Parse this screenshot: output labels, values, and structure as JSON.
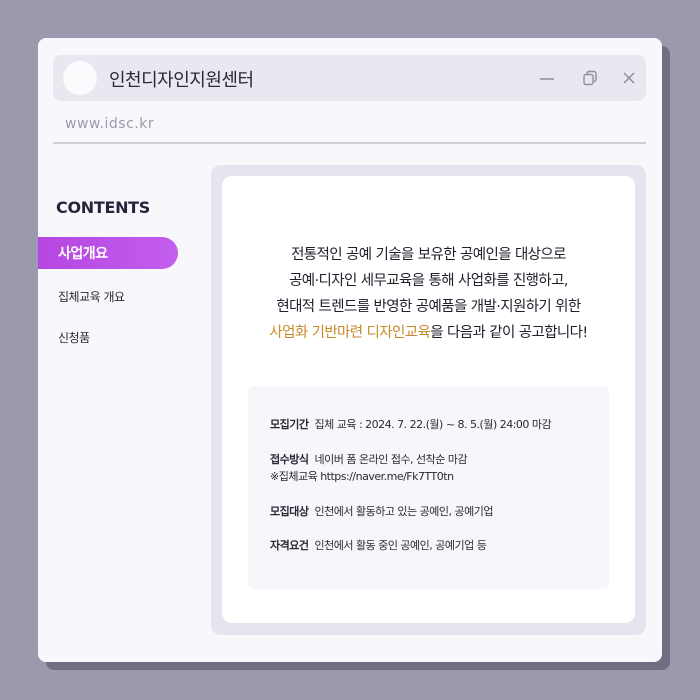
{
  "window": {
    "title": "인천디자인지원센터",
    "url": "www.idsc.kr"
  },
  "sidebar": {
    "heading": "CONTENTS",
    "items": [
      {
        "label": "사업개요",
        "active": true
      },
      {
        "label": "집체교육 개요",
        "active": false
      },
      {
        "label": "신청품",
        "active": false
      }
    ]
  },
  "intro": {
    "line1": "전통적인 공예 기술을 보유한 공예인을 대상으로",
    "line2": "공예·디자인 세무교육을 통해 사업화를 진행하고,",
    "line3": "현대적 트렌드를 반영한 공예품을 개발·지원하기 위한",
    "line4_highlight": "사업화 기반마련 디자인교육",
    "line4_rest": "을 다음과 같이 공고합니다!"
  },
  "info": {
    "rows": [
      {
        "label": "모집기간",
        "value": "집체 교육 : 2024. 7. 22.(월) ~ 8. 5.(월) 24:00 마감"
      },
      {
        "label": "접수방식",
        "value": "네이버 폼 온라인 접수, 선착순 마감",
        "extra": "※집체교육 https://naver.me/Fk7TT0tn"
      },
      {
        "label": "모집대상",
        "value": "인천에서 활동하고 있는 공예인, 공예기업"
      },
      {
        "label": "자격요건",
        "value": "인천에서 활동 중인 공예인, 공예기업 등"
      }
    ]
  },
  "colors": {
    "accent": "#c35eee",
    "highlight": "#c98a2a",
    "background": "#9a99ad"
  },
  "icons": {
    "minimize": "minimize-icon",
    "restore": "restore-icon",
    "close": "close-icon"
  }
}
